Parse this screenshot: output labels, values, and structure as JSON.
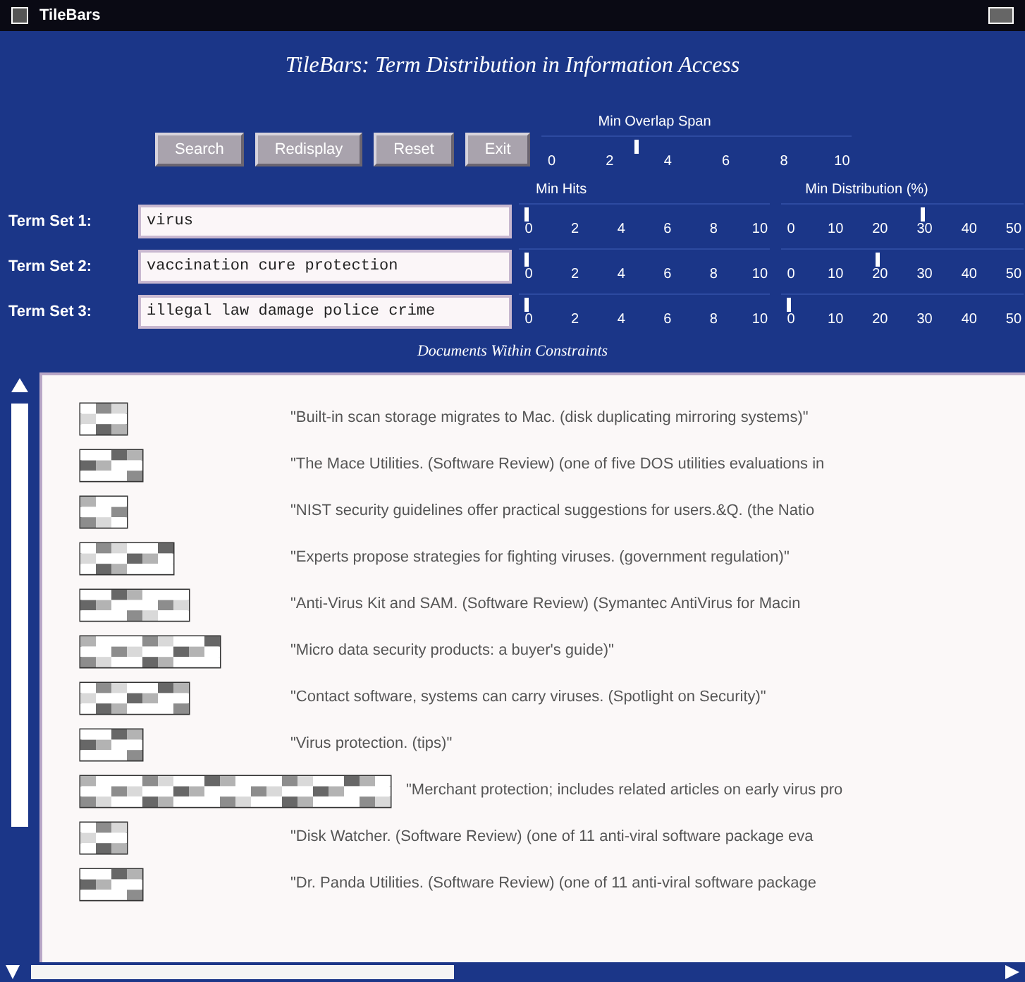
{
  "window": {
    "title": "TileBars"
  },
  "heading": "TileBars: Term Distribution in Information Access",
  "buttons": [
    "Search",
    "Redisplay",
    "Reset",
    "Exit"
  ],
  "overlap": {
    "label": "Min Overlap Span",
    "ticks": [
      "0",
      "2",
      "4",
      "6",
      "8",
      "10"
    ],
    "level": 0.3
  },
  "hits_label": "Min Hits",
  "distribution_label": "Min Distribution (%)",
  "term_sets": [
    {
      "label": "Term Set 1:",
      "value": "virus",
      "hits": {
        "ticks": [
          "0",
          "2",
          "4",
          "6",
          "8",
          "10"
        ],
        "level": 0
      },
      "distribution": {
        "ticks": [
          "0",
          "10",
          "20",
          "30",
          "40",
          "50"
        ],
        "level": 0.6
      }
    },
    {
      "label": "Term Set 2:",
      "value": "vaccination cure protection",
      "hits": {
        "ticks": [
          "0",
          "2",
          "4",
          "6",
          "8",
          "10"
        ],
        "level": 0
      },
      "distribution": {
        "ticks": [
          "0",
          "10",
          "20",
          "30",
          "40",
          "50"
        ],
        "level": 0.4
      }
    },
    {
      "label": "Term Set 3:",
      "value": "illegal law damage police crime",
      "hits": {
        "ticks": [
          "0",
          "2",
          "4",
          "6",
          "8",
          "10"
        ],
        "level": 0
      },
      "distribution": {
        "ticks": [
          "0",
          "10",
          "20",
          "30",
          "40",
          "50"
        ],
        "level": 0
      }
    }
  ],
  "results_label": "Documents Within Constraints",
  "documents": [
    {
      "title": "\"Built-in scan storage migrates to Mac. (disk duplicating mirroring systems)\""
    },
    {
      "title": "\"The Mace Utilities. (Software Review) (one of five DOS utilities evaluations in"
    },
    {
      "title": "\"NIST security guidelines offer practical suggestions for users.&Q. (the Natio"
    },
    {
      "title": "\"Experts propose strategies for fighting viruses. (government regulation)\""
    },
    {
      "title": "\"Anti-Virus Kit and SAM. (Software Review) (Symantec AntiVirus for Macin"
    },
    {
      "title": "\"Micro data security products: a buyer's guide)\""
    },
    {
      "title": "\"Contact software, systems can carry viruses. (Spotlight on Security)\""
    },
    {
      "title": "\"Virus protection. (tips)\""
    },
    {
      "title": "\"Merchant protection; includes related articles on early virus pro"
    },
    {
      "title": "\"Disk Watcher. (Software Review) (one of 11 anti-viral software package eva"
    },
    {
      "title": "\"Dr. Panda Utilities. (Software Review) (one of 11 anti-viral software package"
    }
  ]
}
